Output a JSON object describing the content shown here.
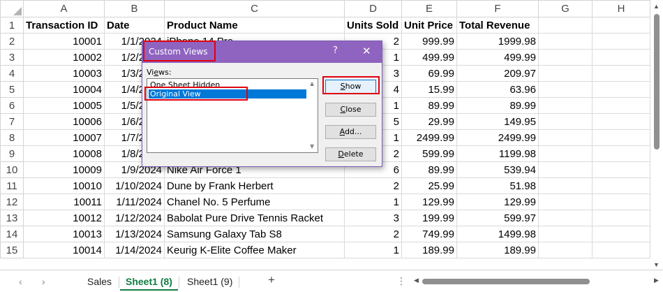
{
  "columns": [
    "A",
    "B",
    "C",
    "D",
    "E",
    "F",
    "G",
    "H"
  ],
  "header_row": [
    "Transaction ID",
    "Date",
    "Product Name",
    "Units Sold",
    "Unit Price",
    "Total Revenue",
    "",
    ""
  ],
  "rows": [
    [
      "10001",
      "1/1/2024",
      "iPhone 14 Pro",
      "2",
      "999.99",
      "1999.98"
    ],
    [
      "10002",
      "1/2/2024",
      "",
      "1",
      "499.99",
      "499.99"
    ],
    [
      "10003",
      "1/3/2024",
      "",
      "3",
      "69.99",
      "209.97"
    ],
    [
      "10004",
      "1/4/2024",
      "",
      "4",
      "15.99",
      "63.96"
    ],
    [
      "10005",
      "1/5/2024",
      "",
      "1",
      "89.99",
      "89.99"
    ],
    [
      "10006",
      "1/6/2024",
      "",
      "5",
      "29.99",
      "149.95"
    ],
    [
      "10007",
      "1/7/2024",
      "",
      "1",
      "2499.99",
      "2499.99"
    ],
    [
      "10008",
      "1/8/2024",
      "",
      "2",
      "599.99",
      "1199.98"
    ],
    [
      "10009",
      "1/9/2024",
      "Nike Air Force 1",
      "6",
      "89.99",
      "539.94"
    ],
    [
      "10010",
      "1/10/2024",
      "Dune by Frank Herbert",
      "2",
      "25.99",
      "51.98"
    ],
    [
      "10011",
      "1/11/2024",
      "Chanel No. 5 Perfume",
      "1",
      "129.99",
      "129.99"
    ],
    [
      "10012",
      "1/12/2024",
      "Babolat Pure Drive Tennis Racket",
      "3",
      "199.99",
      "599.97"
    ],
    [
      "10013",
      "1/13/2024",
      "Samsung Galaxy Tab S8",
      "2",
      "749.99",
      "1499.98"
    ],
    [
      "10014",
      "1/14/2024",
      "Keurig K-Elite Coffee Maker",
      "1",
      "189.99",
      "189.99"
    ]
  ],
  "dialog": {
    "title": "Custom Views",
    "help": "?",
    "close": "✕",
    "views_label": "Views:",
    "views": [
      "One Sheet Hidden",
      "Original View"
    ],
    "selected_index": 1,
    "buttons": {
      "show": "Show",
      "close": "Close",
      "add": "Add...",
      "delete": "Delete"
    }
  },
  "tabs": {
    "items": [
      "Sales",
      "Sheet1 (8)",
      "Sheet1 (9)"
    ],
    "active_index": 1,
    "add": "+",
    "dots": "⋮"
  },
  "colors": {
    "title_bar": "#8f64c0",
    "selection": "#0078d7",
    "highlight": "#e0000f",
    "active_tab": "#107c41"
  },
  "icons": {
    "prev_sheet": "chevron-left-icon",
    "next_sheet": "chevron-right-icon",
    "add_sheet": "plus-icon",
    "scroll_up": "triangle-up-icon",
    "scroll_down": "triangle-down-icon",
    "scroll_left": "triangle-left-icon",
    "scroll_right": "triangle-right-icon",
    "dialog_close": "close-icon",
    "dialog_help": "help-icon"
  }
}
